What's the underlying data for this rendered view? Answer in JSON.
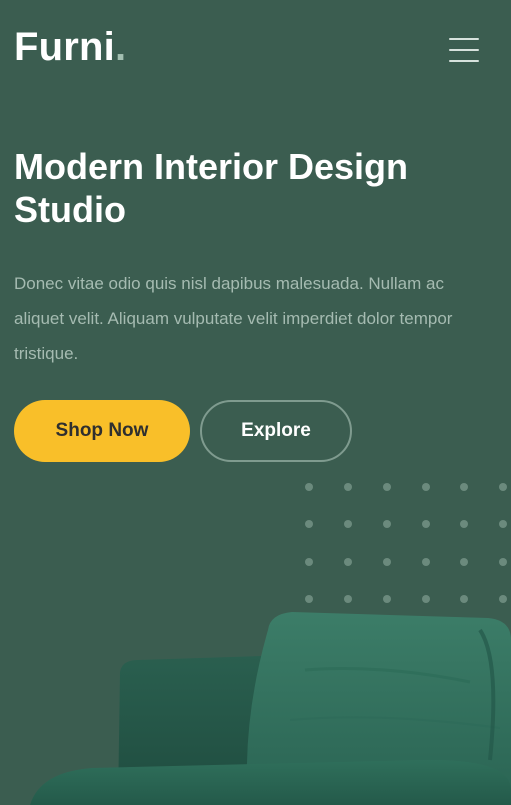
{
  "header": {
    "logo_text": "Furni",
    "logo_dot": "."
  },
  "hero": {
    "title_line1": "Modern Interior Design",
    "title_line2": "Studio",
    "description": "Donec vitae odio quis nisl dapibus malesuada. Nullam ac aliquet velit. Aliquam vulputate velit imperdiet dolor tempor tristique.",
    "primary_button": "Shop Now",
    "secondary_button": "Explore"
  },
  "colors": {
    "background": "#3b5d50",
    "accent": "#f9bf29",
    "text_muted": "#a5bbb1",
    "sofa": "#2d6b58"
  },
  "icons": {
    "menu": "hamburger-icon"
  }
}
